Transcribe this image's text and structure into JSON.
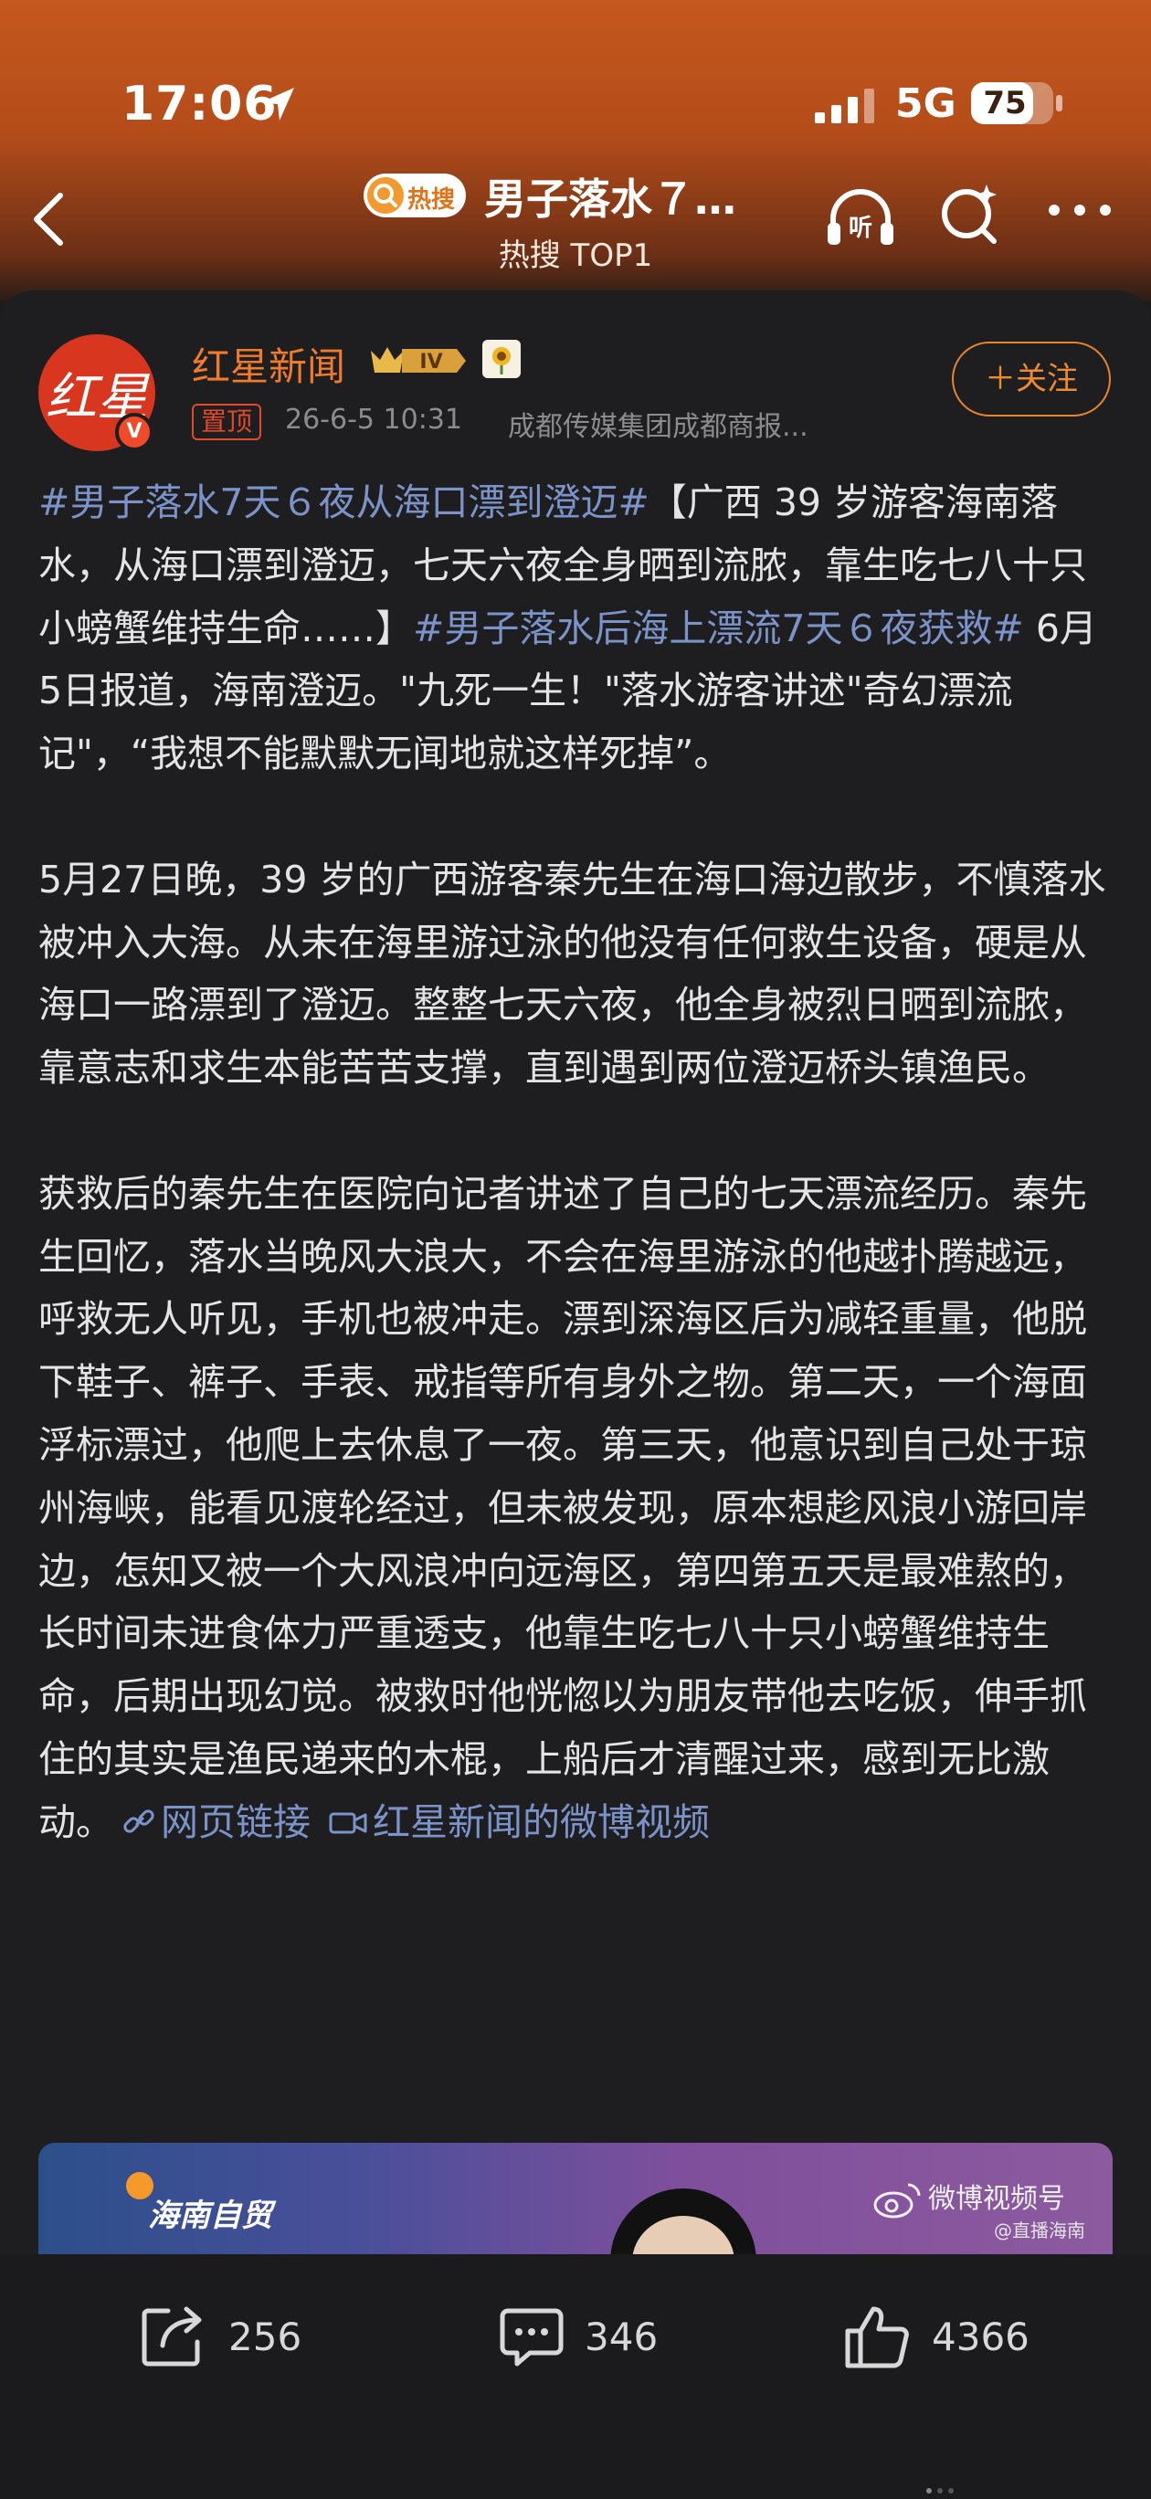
{
  "status_bar": {
    "time": "17:06",
    "network": "5G",
    "battery": "75",
    "battery_level": 0.75
  },
  "nav": {
    "badge": "热搜",
    "title": "男子落水７…",
    "subtitle": "热搜 TOP1"
  },
  "author": {
    "avatar_text": "红星",
    "name": "红星新闻",
    "level": "IV",
    "pin_tag": "置顶",
    "time": "26-6-5 10:31",
    "source": "成都传媒集团成都商报...",
    "follow_label": "＋关注"
  },
  "post": {
    "p1": {
      "tag1": "#男子落水7天６夜从海口漂到澄迈#",
      "text1": "【广西 39 岁游客海南落水，从海口漂到澄迈，七天六夜全身晒到流脓，靠生吃七八十只小螃蟹维持生命……】",
      "tag2": "#男子落水后海上漂流7天６夜获救#",
      "text2": " 6月5日报道，海南澄迈。\"九死一生！\"落水游客讲述\"奇幻漂流记\"，“我想不能默默无闻地就这样死掉”。"
    },
    "p2": "5月27日晚，39 岁的广西游客秦先生在海口海边散步，不慎落水被冲入大海。从未在海里游过泳的他没有任何救生设备，硬是从海口一路漂到了澄迈。整整七天六夜，他全身被烈日晒到流脓，靠意志和求生本能苦苦支撑，直到遇到两位澄迈桥头镇渔民。",
    "p3": "获救后的秦先生在医院向记者讲述了自己的七天漂流经历。秦先生回忆，落水当晚风大浪大，不会在海里游泳的他越扑腾越远，呼救无人听见，手机也被冲走。漂到深海区后为减轻重量，他脱下鞋子、裤子、手表、戒指等所有身外之物。第二天，一个海面浮标漂过，他爬上去休息了一夜。第三天，他意识到自己处于琼州海峡，能看见渡轮经过，但未被发现，原本想趁风浪小游回岸边，怎知又被一个大风浪冲向远海区，第四第五天是最难熬的，长时间未进食体力严重透支，他靠生吃七八十只小螃蟹维持生命，后期出现幻觉。被救时他恍惚以为朋友带他去吃饭，伸手抓住的其实是渔民递来的木棍，上船后才清醒过来，感到无比激动。",
    "link1": "网页链接",
    "link2": "红星新闻的微博视频"
  },
  "video": {
    "channel_logo": "海南自贸",
    "watermark": "微博视频号",
    "watermark_sub": "@直播海南"
  },
  "actions": {
    "repost": "256",
    "comment": "346",
    "like": "4366"
  },
  "colors": {
    "accent": "#f07b2a",
    "link": "#7b93c9",
    "background": "#1e1e20"
  }
}
